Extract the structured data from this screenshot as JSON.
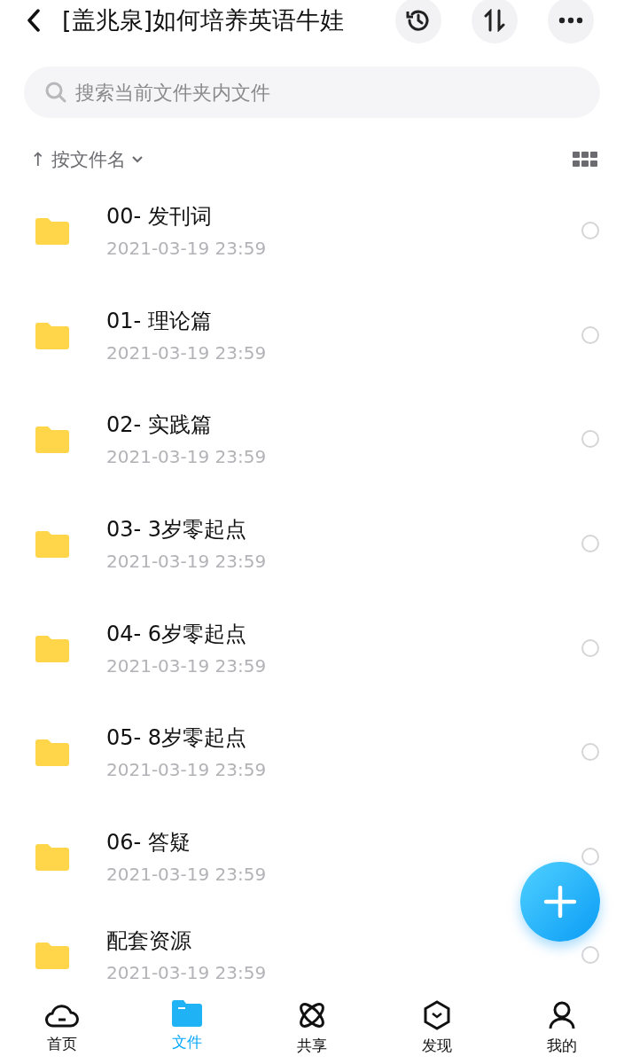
{
  "header": {
    "title": "[盖兆泉]如何培养英语牛娃"
  },
  "search": {
    "placeholder": "搜索当前文件夹内文件"
  },
  "sort": {
    "arrow": "↑",
    "label": "按文件名"
  },
  "files": [
    {
      "name": "00- 发刊词",
      "date": "2021-03-19 23:59",
      "selected": false
    },
    {
      "name": "01- 理论篇",
      "date": "2021-03-19 23:59",
      "selected": false
    },
    {
      "name": "02- 实践篇",
      "date": "2021-03-19 23:59",
      "selected": false
    },
    {
      "name": "03- 3岁零起点",
      "date": "2021-03-19 23:59",
      "selected": false
    },
    {
      "name": "04- 6岁零起点",
      "date": "2021-03-19 23:59",
      "selected": false
    },
    {
      "name": "05- 8岁零起点",
      "date": "2021-03-19 23:59",
      "selected": false
    },
    {
      "name": "06- 答疑",
      "date": "2021-03-19 23:59",
      "selected": false
    },
    {
      "name": "配套资源",
      "date": "2021-03-19 23:59",
      "selected": false
    }
  ],
  "tabs": [
    {
      "label": "首页",
      "kind": "home",
      "selected": false
    },
    {
      "label": "文件",
      "kind": "files",
      "selected": true
    },
    {
      "label": "共享",
      "kind": "share",
      "selected": false
    },
    {
      "label": "发现",
      "kind": "discover",
      "selected": false
    },
    {
      "label": "我的",
      "kind": "me",
      "selected": false
    }
  ]
}
